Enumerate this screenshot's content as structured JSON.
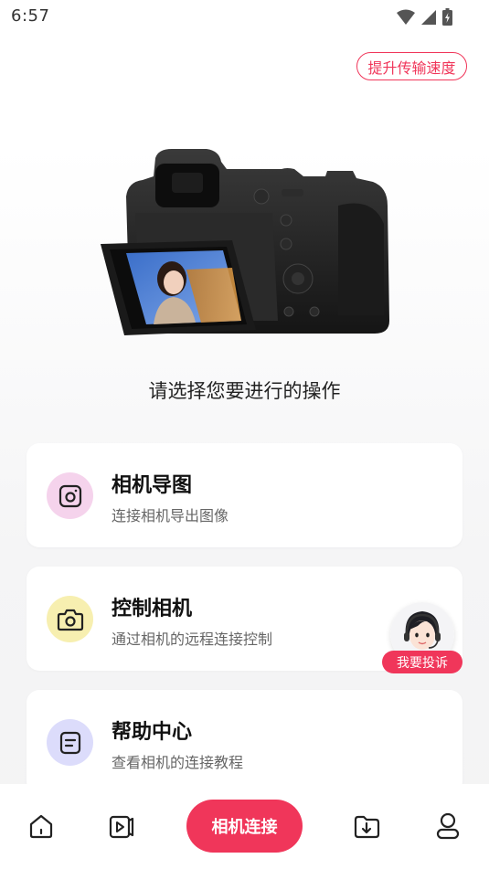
{
  "status_bar": {
    "time": "6:57"
  },
  "header": {
    "speed_button_label": "提升传输速度"
  },
  "main": {
    "prompt": "请选择您要进行的操作",
    "cards": [
      {
        "title": "相机导图",
        "subtitle": "连接相机导出图像",
        "icon": "camera-square-icon",
        "icon_bg": "#f5d3ec"
      },
      {
        "title": "控制相机",
        "subtitle": "通过相机的远程连接控制",
        "icon": "camera-icon",
        "icon_bg": "#f7efb0"
      },
      {
        "title": "帮助中心",
        "subtitle": "查看相机的连接教程",
        "icon": "document-icon",
        "icon_bg": "#dcdcfb"
      }
    ]
  },
  "support": {
    "label": "我要投诉"
  },
  "bottom_nav": {
    "connect_label": "相机连接",
    "items": [
      "home-icon",
      "video-icon",
      "folder-download-icon",
      "profile-icon"
    ]
  },
  "colors": {
    "accent": "#f0365a"
  }
}
